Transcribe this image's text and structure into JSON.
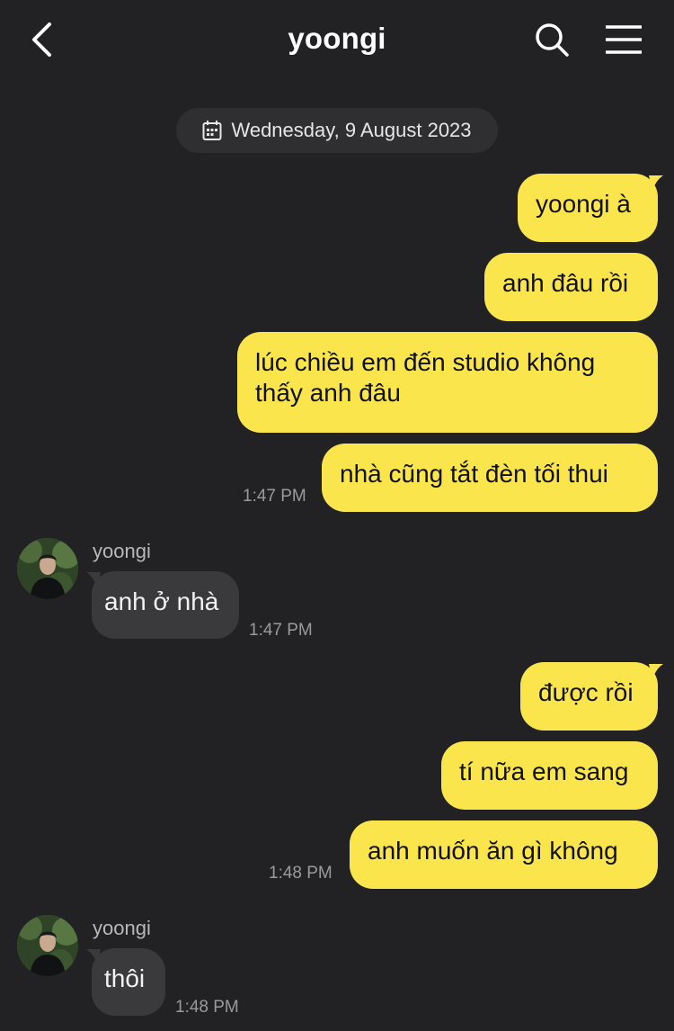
{
  "header": {
    "title": "yoongi"
  },
  "date_divider": "Wednesday, 9 August 2023",
  "messages": {
    "m1": "yoongi à",
    "m2": "anh đâu rồi",
    "m3": "lúc chiều em đến studio không thấy anh đâu",
    "m4": "nhà cũng tắt đèn tối thui",
    "m4_time": "1:47 PM",
    "r1_sender": "yoongi",
    "r1": "anh ở nhà",
    "r1_time": "1:47 PM",
    "m5": "được rồi",
    "m6": "tí nữa em sang",
    "m7": "anh muốn ăn gì không",
    "m7_time": "1:48 PM",
    "r2_sender": "yoongi",
    "r2": "thôi",
    "r2_time": "1:48 PM"
  },
  "colors": {
    "background": "#222224",
    "sent_bubble": "#fae64c",
    "received_bubble": "#3a3a3d"
  }
}
